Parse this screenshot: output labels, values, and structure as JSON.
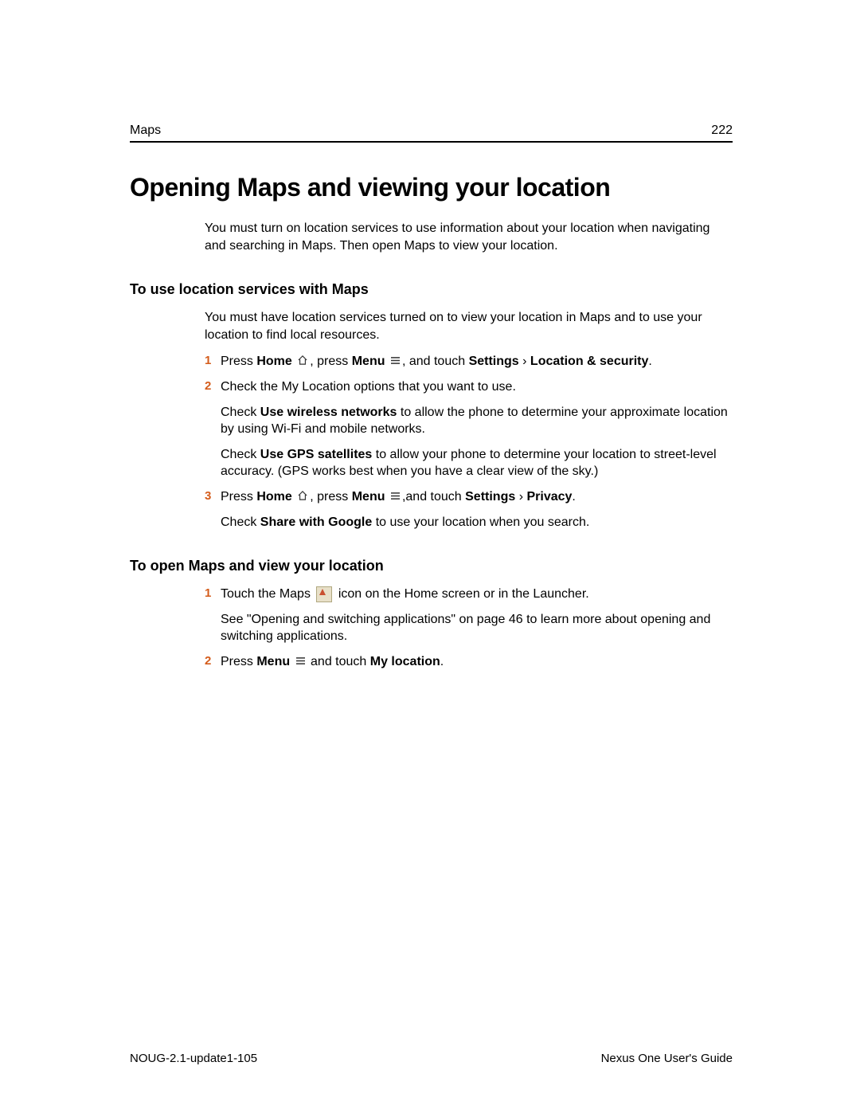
{
  "header": {
    "section": "Maps",
    "page_number": "222"
  },
  "title": "Opening Maps and viewing your location",
  "intro": "You must turn on location services to use information about your location when navigating and searching in Maps. Then open Maps to view your location.",
  "section1": {
    "heading": "To use location services with Maps",
    "lead": "You must have location services turned on to view your location in Maps and to use your location to find local resources.",
    "step1": {
      "num": "1",
      "t1": "Press ",
      "home": "Home",
      "t2": ", press ",
      "menu": "Menu",
      "t3": ", and touch ",
      "settings": "Settings",
      "sep": " › ",
      "loc": "Location & security",
      "end": "."
    },
    "step2": {
      "num": "2",
      "line1": "Check the My Location options that you want to use.",
      "p2a": "Check ",
      "p2b": "Use wireless networks",
      "p2c": " to allow the phone to determine your approximate location by using Wi-Fi and mobile networks.",
      "p3a": "Check ",
      "p3b": "Use GPS satellites",
      "p3c": " to allow your phone to determine your location to street-level accuracy. (GPS works best when you have a clear view of the sky.)"
    },
    "step3": {
      "num": "3",
      "t1": "Press ",
      "home": "Home",
      "t2": ", press ",
      "menu": "Menu",
      "t3": ",and touch ",
      "settings": "Settings",
      "sep": " › ",
      "priv": "Privacy",
      "end": ".",
      "p2a": "Check ",
      "p2b": "Share with Google",
      "p2c": " to use your location when you search."
    }
  },
  "section2": {
    "heading": "To open Maps and view your location",
    "step1": {
      "num": "1",
      "t1": "Touch the Maps ",
      "t2": " icon on the Home screen or in the Launcher.",
      "p2": "See \"Opening and switching applications\" on page 46 to learn more about opening and switching applications."
    },
    "step2": {
      "num": "2",
      "t1": "Press ",
      "menu": "Menu",
      "t2": " and touch ",
      "myloc": "My location",
      "end": "."
    }
  },
  "footer": {
    "left": "NOUG-2.1-update1-105",
    "right": "Nexus One User's Guide"
  }
}
